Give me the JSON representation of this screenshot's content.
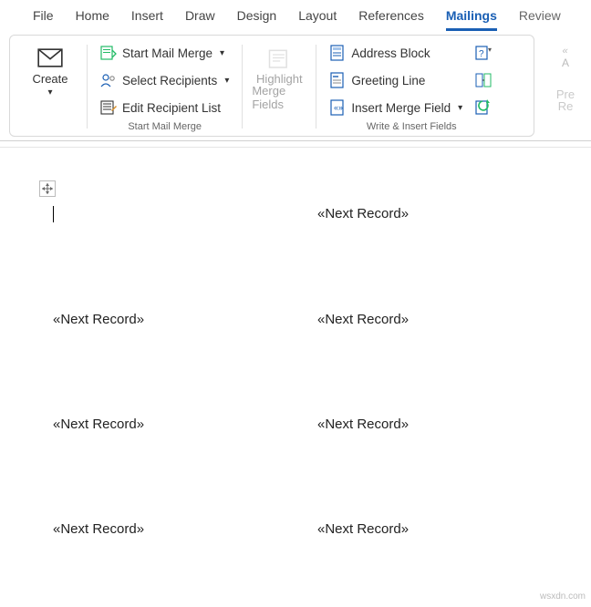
{
  "tabs": {
    "file": "File",
    "home": "Home",
    "insert": "Insert",
    "draw": "Draw",
    "design": "Design",
    "layout": "Layout",
    "references": "References",
    "mailings": "Mailings",
    "review": "Review"
  },
  "ribbon": {
    "create": {
      "label": "Create"
    },
    "startMailMerge": {
      "cmd1": "Start Mail Merge",
      "cmd2": "Select Recipients",
      "cmd3": "Edit Recipient List",
      "groupLabel": "Start Mail Merge"
    },
    "highlight": {
      "line1": "Highlight",
      "line2": "Merge Fields"
    },
    "writeInsert": {
      "cmd1": "Address Block",
      "cmd2": "Greeting Line",
      "cmd3": "Insert Merge Field",
      "groupLabel": "Write & Insert Fields"
    },
    "preview": {
      "line1": "Pre",
      "line2": "Re",
      "sideA": "A"
    }
  },
  "doc": {
    "fieldText": "«Next Record»",
    "cells": [
      "",
      "field",
      "field",
      "field",
      "field",
      "field",
      "field",
      "field"
    ]
  },
  "watermark": "wsxdn.com"
}
